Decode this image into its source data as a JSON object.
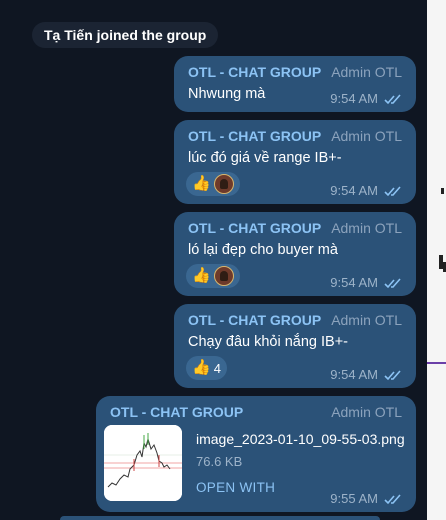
{
  "service": {
    "joined_text": "Tạ Tiến joined the group"
  },
  "messages": [
    {
      "sender": "OTL - CHAT GROUP",
      "role": "Admin OTL",
      "text": "Nhwung mà",
      "time": "9:54 AM"
    },
    {
      "sender": "OTL - CHAT GROUP",
      "role": "Admin OTL",
      "text": "lúc đó giá về range IB+-",
      "time": "9:54 AM",
      "reaction": {
        "emoji": "👍",
        "count": ""
      }
    },
    {
      "sender": "OTL - CHAT GROUP",
      "role": "Admin OTL",
      "text": "ló lại đẹp cho buyer mà",
      "time": "9:54 AM",
      "reaction": {
        "emoji": "👍",
        "count": ""
      }
    },
    {
      "sender": "OTL - CHAT GROUP",
      "role": "Admin OTL",
      "text": "Chạy đâu khỏi nắng IB+-",
      "time": "9:54 AM",
      "reaction": {
        "emoji": "👍",
        "count": "4"
      }
    },
    {
      "sender": "OTL - CHAT GROUP",
      "role": "Admin OTL",
      "time": "9:55 AM",
      "file": {
        "name": "image_2023-01-10_09-55-03.png",
        "size": "76.6 KB",
        "action": "OPEN WITH"
      }
    }
  ],
  "colors": {
    "background": "#0f1622",
    "bubble": "#2b5278",
    "sender": "#8cc3f4",
    "meta": "#9db3c9"
  },
  "icons": {
    "read_status": "double-check-icon",
    "reaction_avatar": "user-avatar-icon"
  }
}
